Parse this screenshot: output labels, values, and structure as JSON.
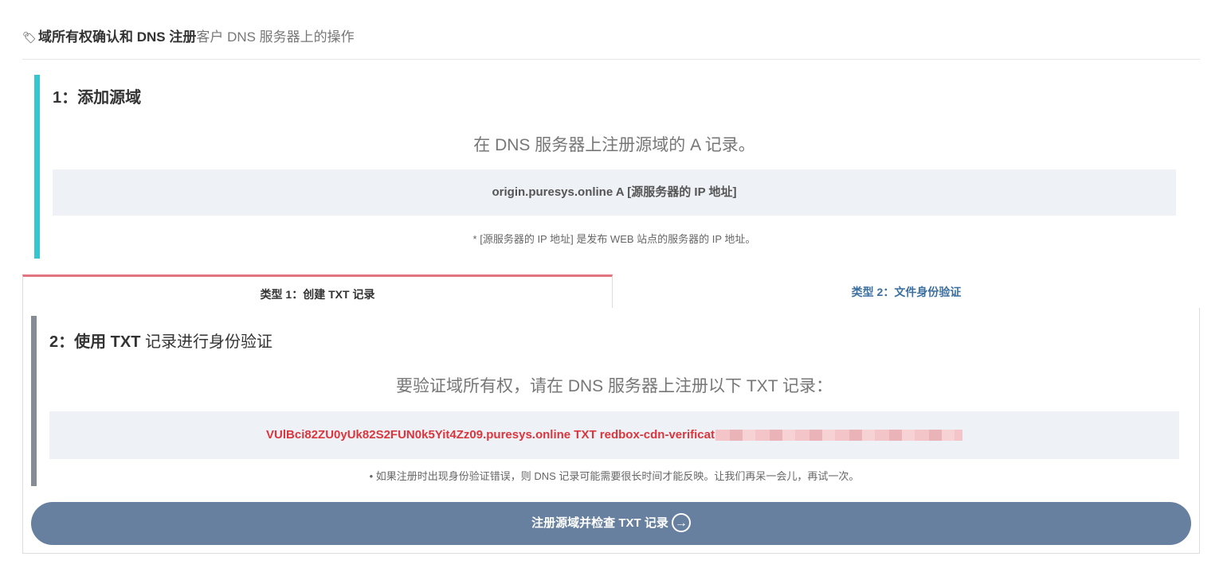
{
  "header": {
    "icon": "tag-icon",
    "title_bold": "域所有权确认和 DNS 注册",
    "title_sub": "客户 DNS 服务器上的操作"
  },
  "step1": {
    "title": "1：添加源域",
    "description": "在 DNS 服务器上注册源域的 A 记录。",
    "record": "origin.puresys.online A [源服务器的 IP 地址]",
    "note": "* [源服务器的 IP 地址] 是发布 WEB 站点的服务器的 IP 地址。",
    "accent_color": "#36c6d0"
  },
  "tabs": [
    {
      "label": "类型 1：创建 TXT 记录",
      "active": true
    },
    {
      "label": "类型 2：文件身份验证",
      "active": false
    }
  ],
  "step2": {
    "title_bold": "2：使用 TXT ",
    "title_light": "记录进行身份验证",
    "description": "要验证域所有权，请在 DNS 服务器上注册以下 TXT 记录：",
    "record_visible": "VUlBci82ZU0yUk82S2FUN0k5Yit4Zz09.puresys.online TXT redbox-cdn-verificat",
    "note": "• 如果注册时出现身份验证错误，则 DNS 记录可能需要很长时间才能反映。让我们再呆一会儿，再试一次。",
    "accent_color": "#868c96"
  },
  "button": {
    "label": "注册源域并检查 TXT 记录",
    "icon": "arrow-right-circle-icon",
    "color": "#67809f"
  }
}
